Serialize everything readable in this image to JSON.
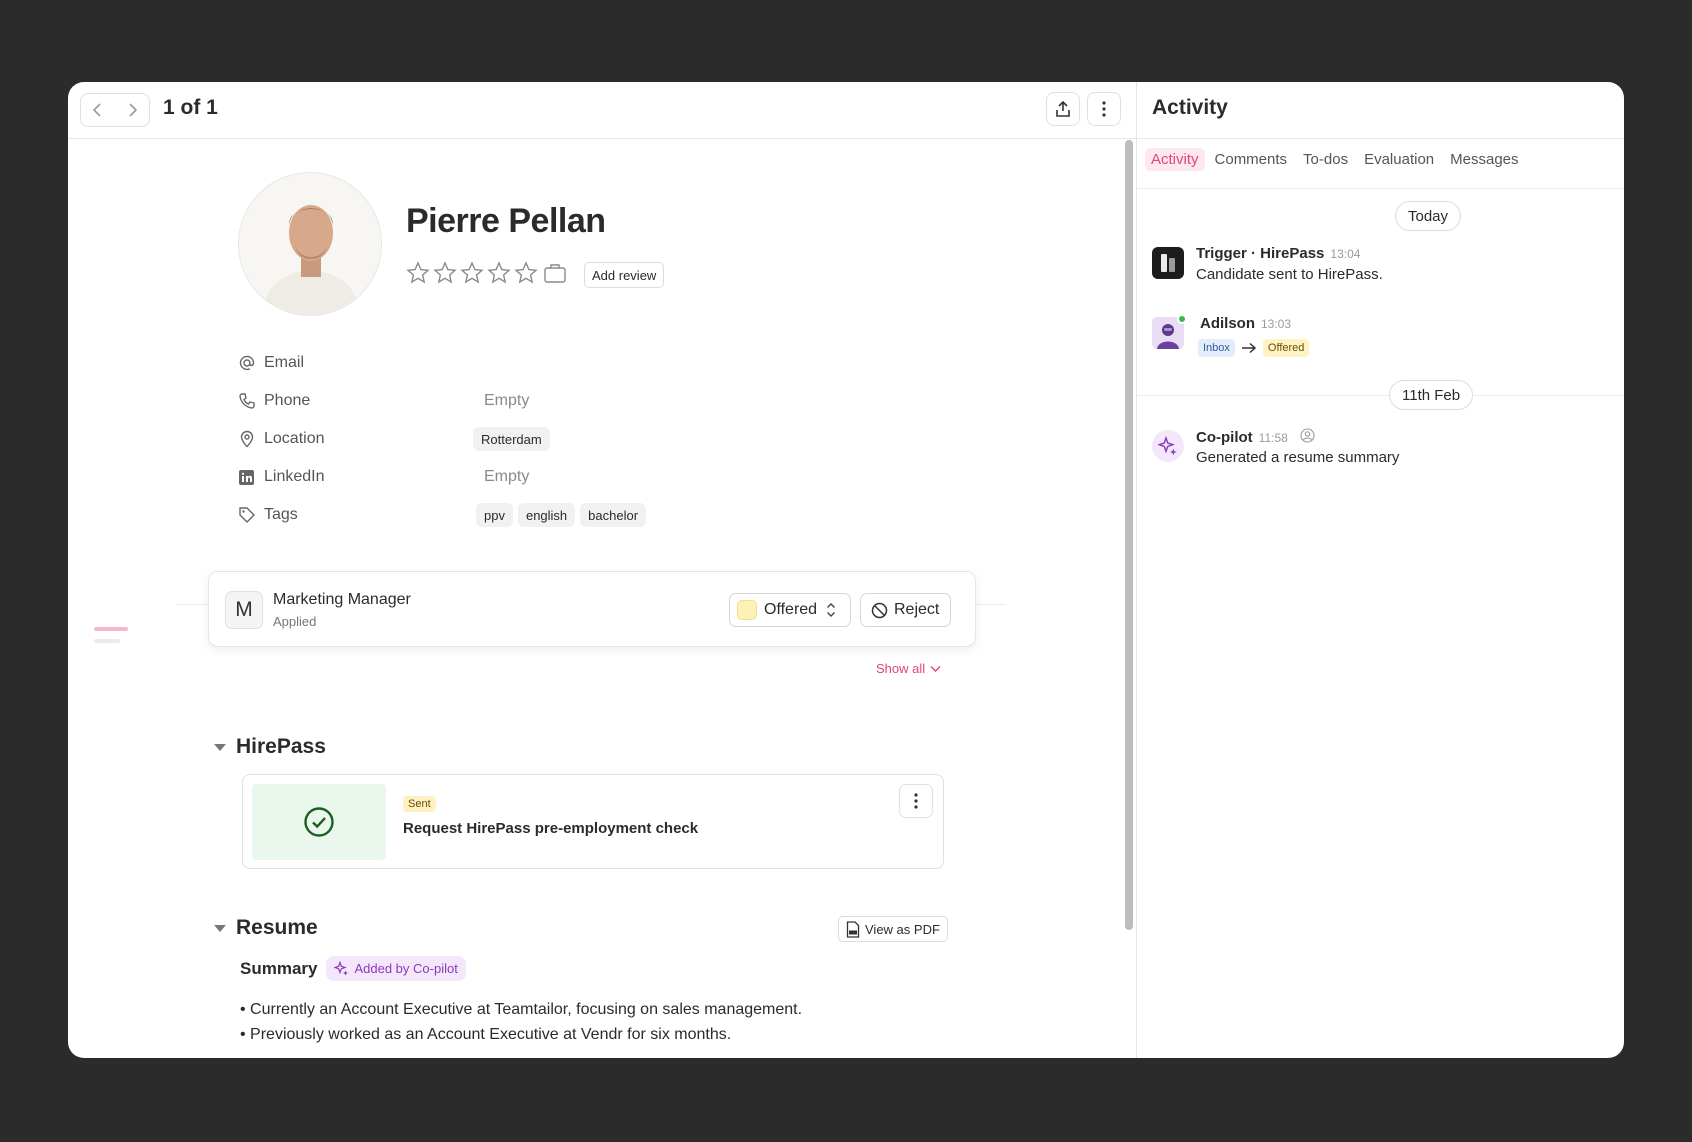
{
  "nav": {
    "pager": "1 of 1"
  },
  "candidate": {
    "name": "Pierre Pellan",
    "add_review_label": "Add review",
    "fields": {
      "email_label": "Email",
      "phone_label": "Phone",
      "phone_value": "Empty",
      "location_label": "Location",
      "location_value": "Rotterdam",
      "linkedin_label": "LinkedIn",
      "linkedin_value": "Empty",
      "tags_label": "Tags",
      "tags": [
        "ppv",
        "english",
        "bachelor"
      ]
    }
  },
  "job": {
    "initial": "M",
    "title": "Marketing Manager",
    "subtitle": "Applied",
    "stage": "Offered",
    "reject_label": "Reject",
    "show_all_label": "Show all"
  },
  "hirepass": {
    "section_title": "HirePass",
    "badge": "Sent",
    "title": "Request HirePass pre-employment check"
  },
  "resume": {
    "section_title": "Resume",
    "pdf_label": "View as PDF",
    "summary_label": "Summary",
    "copilot_badge": "Added by Co-pilot",
    "bullets": [
      "• Currently an Account Executive at Teamtailor, focusing on sales management.",
      "• Previously worked as an Account Executive at Vendr for six months."
    ]
  },
  "activity": {
    "title": "Activity",
    "tabs": [
      "Activity",
      "Comments",
      "To-dos",
      "Evaluation",
      "Messages"
    ],
    "dates": [
      "Today",
      "11th Feb"
    ],
    "items": [
      {
        "who": "Trigger · HirePass",
        "time": "13:04",
        "text": "Candidate sent to HirePass."
      },
      {
        "who": "Adilson",
        "time": "13:03",
        "from": "Inbox",
        "to": "Offered"
      },
      {
        "who": "Co-pilot",
        "time": "11:58",
        "text": "Generated a resume summary"
      }
    ]
  },
  "colors": {
    "accent": "#e0457b",
    "offered_swatch": "#fdf1b5",
    "copilot_purple": "#8a3ab9",
    "online_green": "#2fbf4a"
  }
}
